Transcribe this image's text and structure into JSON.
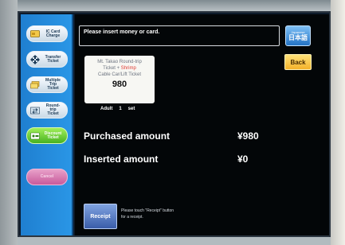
{
  "menu": {
    "items": [
      {
        "label": "IC Card\nCharge",
        "icon": "card-icon",
        "state": "normal"
      },
      {
        "label": "Transfer\nTicket",
        "icon": "transfer-arrows-icon",
        "state": "normal"
      },
      {
        "label": "Multiple\nTrip\nTicket",
        "icon": "ticket-stack-icon",
        "state": "normal"
      },
      {
        "label": "Round-\ntrip\nTicket",
        "icon": "round-trip-icon",
        "state": "normal"
      },
      {
        "label": "Discount\nTicket",
        "icon": "discount-ticket-icon",
        "state": "active"
      },
      {
        "label": "Cancel",
        "icon": "",
        "state": "disabled"
      }
    ]
  },
  "message": "Please insert money or card.",
  "language_button": {
    "small": "Japanese",
    "large": "日本語"
  },
  "back_button": "Back",
  "ticket": {
    "line1": "Mt. Takao Round-trip",
    "line2_prefix": "Ticket + ",
    "line2_highlight": "Shrimp",
    "line3": "Cable Car/Lift Ticket",
    "price": "980"
  },
  "quantity": {
    "type": "Adult",
    "count": "1",
    "unit": "set"
  },
  "purchased": {
    "label": "Purchased amount",
    "value": "¥980"
  },
  "inserted": {
    "label": "Inserted amount",
    "value": "¥0"
  },
  "receipt_button": "Receipt",
  "receipt_hint": "Please touch \"Receipt\" button\nfor a receipt.",
  "colors": {
    "menu_bg": "#2a96e6",
    "active": "#48b222",
    "back": "#f4b12a",
    "receipt": "#3a5da9"
  }
}
